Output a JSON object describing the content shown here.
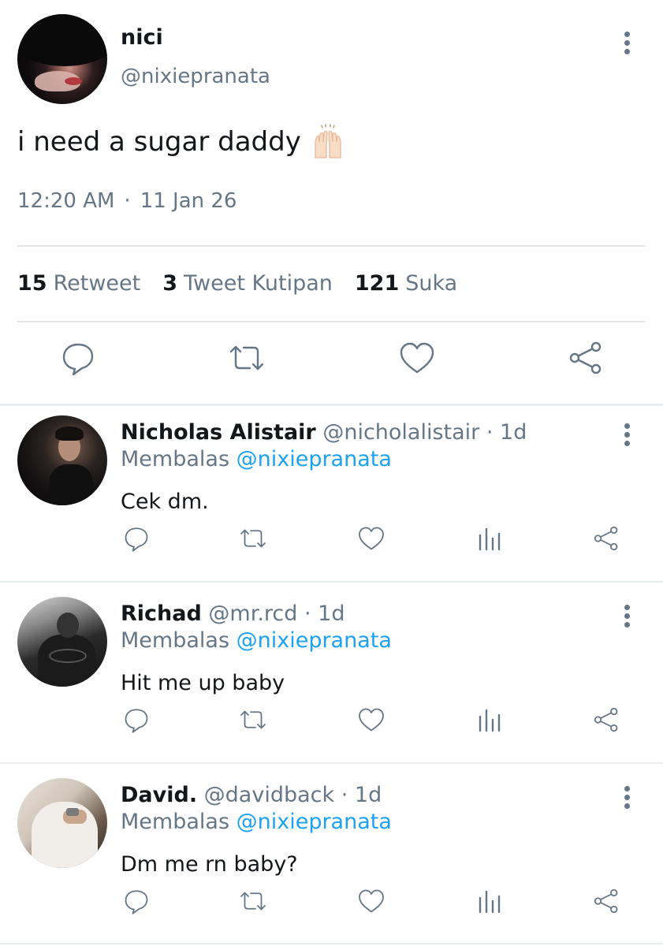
{
  "tweet": {
    "author_name": "nici",
    "author_handle": "@nixiepranata",
    "text": "i need a sugar daddy",
    "emoji_icon": "raising-hands-icon",
    "time": "12:20 AM",
    "separator": "·",
    "date": "11 Jan 26",
    "stats": {
      "retweets_count": "15",
      "retweets_label": "Retweet",
      "quotes_count": "3",
      "quotes_label": "Tweet Kutipan",
      "likes_count": "121",
      "likes_label": "Suka"
    },
    "actions": [
      "reply-icon",
      "retweet-icon",
      "like-icon",
      "share-icon"
    ]
  },
  "replies": [
    {
      "name": "Nicholas Alistair",
      "handle": "@nicholalistair",
      "age": "· 1d",
      "replying_label": "Membalas",
      "replying_to": "@nixiepranata",
      "text": "Cek dm."
    },
    {
      "name": "Richad",
      "handle": "@mr.rcd",
      "age": "· 1d",
      "replying_label": "Membalas",
      "replying_to": "@nixiepranata",
      "text": "Hit me up baby"
    },
    {
      "name": "David.",
      "handle": "@davidback",
      "age": "· 1d",
      "replying_label": "Membalas",
      "replying_to": "@nixiepranata",
      "text": "Dm me rn baby?"
    }
  ],
  "reply_actions": [
    "reply-icon",
    "retweet-icon",
    "like-icon",
    "analytics-icon",
    "share-icon"
  ],
  "colors": {
    "text_primary": "#14171a",
    "text_secondary": "#657786",
    "link": "#1da1f2",
    "divider": "#e1e8ed"
  }
}
